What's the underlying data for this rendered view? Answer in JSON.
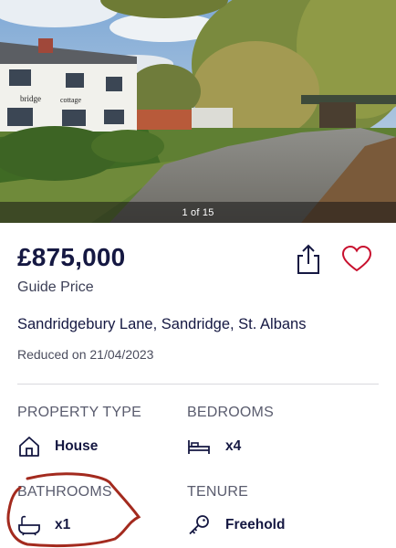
{
  "gallery": {
    "counter": "1 of 15",
    "house_sign_left": "bridge",
    "house_sign_right": "cottage"
  },
  "listing": {
    "price": "£875,000",
    "price_qualifier": "Guide Price",
    "address": "Sandridgebury Lane, Sandridge, St. Albans",
    "reduced": "Reduced on 21/04/2023"
  },
  "details": {
    "property_type": {
      "label": "PROPERTY TYPE",
      "value": "House",
      "icon": "house-icon"
    },
    "bedrooms": {
      "label": "BEDROOMS",
      "value": "x4",
      "icon": "bed-icon"
    },
    "bathrooms": {
      "label": "BATHROOMS",
      "value": "x1",
      "icon": "bath-icon"
    },
    "tenure": {
      "label": "TENURE",
      "value": "Freehold",
      "icon": "key-icon"
    }
  },
  "colors": {
    "text_primary": "#151842",
    "heart": "#c8102e",
    "annotation": "#a32a1e"
  }
}
